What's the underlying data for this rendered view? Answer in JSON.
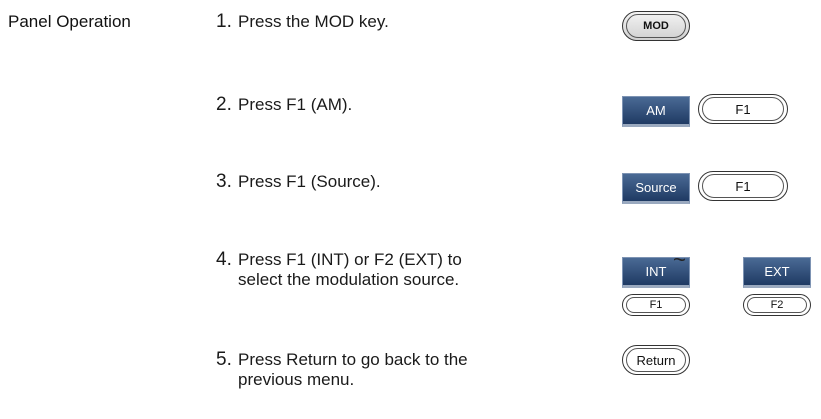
{
  "section_label": "Panel Operation",
  "steps": [
    {
      "number": "1.",
      "text": "Press the MOD key."
    },
    {
      "number": "2.",
      "text": "Press F1 (AM)."
    },
    {
      "number": "3.",
      "text": "Press F1 (Source)."
    },
    {
      "number": "4.",
      "text": "Press F1 (INT) or F2 (EXT) to select the modulation source."
    },
    {
      "number": "5.",
      "text": "Press Return to go back to the previous menu."
    }
  ],
  "keys": {
    "mod": "MOD",
    "am_softkey": "AM",
    "f1": "F1",
    "source_softkey": "Source",
    "int_softkey": "INT",
    "ext_softkey": "EXT",
    "f2": "F2",
    "return": "Return",
    "separator": "~"
  },
  "colors": {
    "softkey_blue": "#2b4a77",
    "text": "#1a1a1a"
  }
}
